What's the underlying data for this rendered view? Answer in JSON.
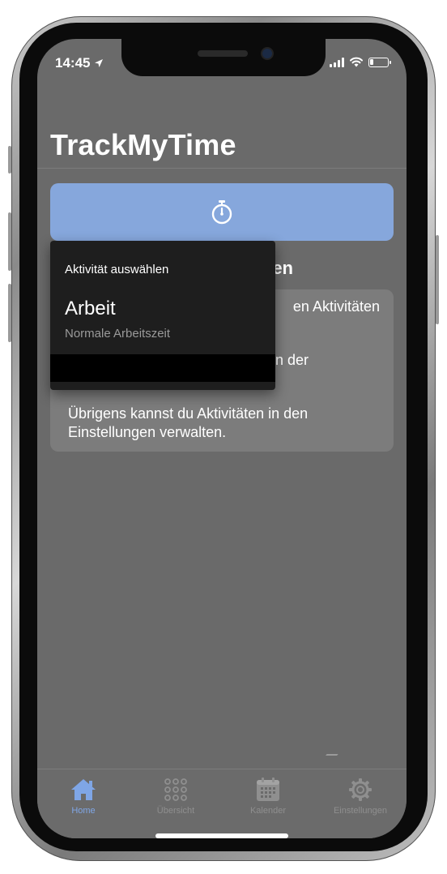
{
  "status_bar": {
    "time": "14:45",
    "location_icon": "location-arrow-icon",
    "icons": [
      "signal-bars-icon",
      "wifi-icon",
      "battery-icon"
    ]
  },
  "app": {
    "title": "TrackMyTime",
    "start_button_icon": "stopwatch-icon",
    "accent_color": "#86a7dc"
  },
  "main": {
    "section_heading_partial": "en",
    "card_lines": [
      "en Aktivitäten",
      "n der",
      "Übrigens kannst du Aktivitäten in den Einstellungen verwalten."
    ]
  },
  "popup": {
    "title": "Aktivität auswählen",
    "items": [
      {
        "title": "Arbeit",
        "subtitle": "Normale Arbeitszeit"
      }
    ]
  },
  "tab_bar": {
    "active_color": "#7fa6e6",
    "tabs": [
      {
        "label": "Home",
        "icon": "home-icon",
        "active": true
      },
      {
        "label": "Übersicht",
        "icon": "grid-dots-icon",
        "active": false
      },
      {
        "label": "Kalender",
        "icon": "calendar-icon",
        "active": false
      },
      {
        "label": "Einstellungen",
        "icon": "gear-icon",
        "active": false
      }
    ]
  }
}
